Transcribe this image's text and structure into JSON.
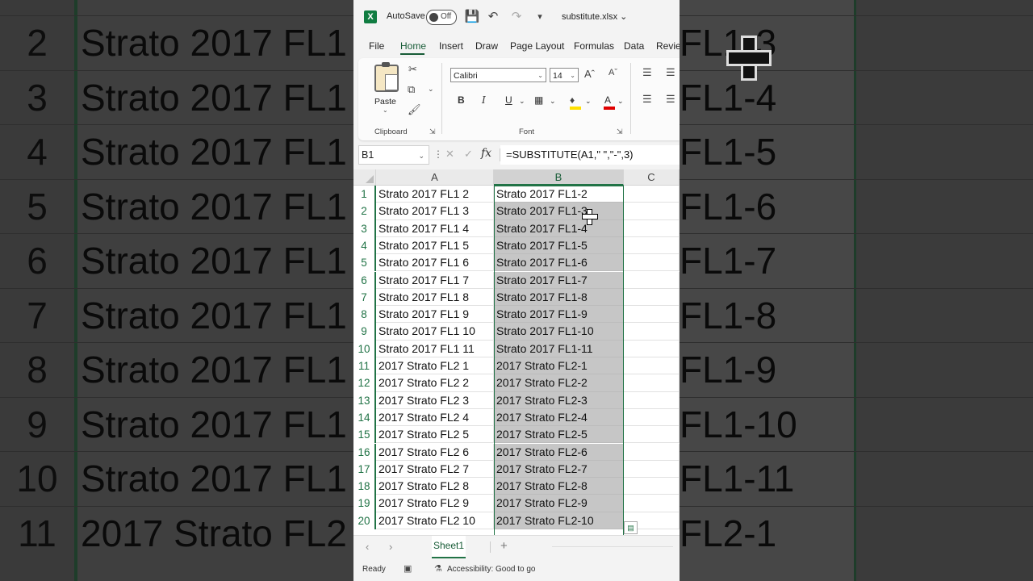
{
  "window": {
    "autosave_label": "AutoSave",
    "autosave_state": "Off",
    "filename": "substitute.xlsx",
    "accent": "#217346"
  },
  "menu": [
    "File",
    "Home",
    "Insert",
    "Draw",
    "Page Layout",
    "Formulas",
    "Data",
    "Revie"
  ],
  "ribbon": {
    "paste_label": "Paste",
    "clipboard_label": "Clipboard",
    "font_label": "Font",
    "font_name": "Calibri",
    "font_size": "14"
  },
  "formula_bar": {
    "name_box": "B1",
    "formula": "=SUBSTITUTE(A1,\" \",\"-\",3)"
  },
  "columns": [
    "A",
    "B",
    "C"
  ],
  "rows": [
    {
      "n": "1",
      "a": "Strato 2017 FL1 2",
      "b": "Strato 2017 FL1-2"
    },
    {
      "n": "2",
      "a": "Strato 2017 FL1 3",
      "b": "Strato 2017 FL1-3"
    },
    {
      "n": "3",
      "a": "Strato 2017 FL1 4",
      "b": "Strato 2017 FL1-4"
    },
    {
      "n": "4",
      "a": "Strato 2017 FL1 5",
      "b": "Strato 2017 FL1-5"
    },
    {
      "n": "5",
      "a": "Strato 2017 FL1 6",
      "b": "Strato 2017 FL1-6"
    },
    {
      "n": "6",
      "a": "Strato 2017 FL1 7",
      "b": "Strato 2017 FL1-7"
    },
    {
      "n": "7",
      "a": "Strato 2017 FL1 8",
      "b": "Strato 2017 FL1-8"
    },
    {
      "n": "8",
      "a": "Strato 2017 FL1 9",
      "b": "Strato 2017 FL1-9"
    },
    {
      "n": "9",
      "a": "Strato 2017 FL1 10",
      "b": "Strato 2017 FL1-10"
    },
    {
      "n": "10",
      "a": "Strato 2017 FL1 11",
      "b": "Strato 2017 FL1-11"
    },
    {
      "n": "11",
      "a": "2017 Strato FL2 1",
      "b": "2017 Strato FL2-1"
    },
    {
      "n": "12",
      "a": "2017 Strato FL2 2",
      "b": "2017 Strato FL2-2"
    },
    {
      "n": "13",
      "a": "2017 Strato FL2 3",
      "b": "2017 Strato FL2-3"
    },
    {
      "n": "14",
      "a": "2017 Strato FL2 4",
      "b": "2017 Strato FL2-4"
    },
    {
      "n": "15",
      "a": "2017 Strato FL2 5",
      "b": "2017 Strato FL2-5"
    },
    {
      "n": "16",
      "a": "2017 Strato FL2 6",
      "b": "2017 Strato FL2-6"
    },
    {
      "n": "17",
      "a": "2017 Strato FL2 7",
      "b": "2017 Strato FL2-7"
    },
    {
      "n": "18",
      "a": "2017 Strato FL2 8",
      "b": "2017 Strato FL2-8"
    },
    {
      "n": "19",
      "a": "2017 Strato FL2 9",
      "b": "2017 Strato FL2-9"
    },
    {
      "n": "20",
      "a": "2017 Strato FL2 10",
      "b": "2017 Strato FL2-10"
    }
  ],
  "sheet_tab": "Sheet1",
  "status": {
    "ready": "Ready",
    "accessibility": "Accessibility: Good to go"
  },
  "background_zoom": {
    "rows": [
      {
        "n": "2",
        "text": "Strato 2017 FL1",
        "right": "FL1-3"
      },
      {
        "n": "3",
        "text": "Strato 2017 FL1",
        "right": "FL1-4"
      },
      {
        "n": "4",
        "text": "Strato 2017 FL1",
        "right": "FL1-5"
      },
      {
        "n": "5",
        "text": "Strato 2017 FL1",
        "right": "FL1-6"
      },
      {
        "n": "6",
        "text": "Strato 2017 FL1",
        "right": "FL1-7"
      },
      {
        "n": "7",
        "text": "Strato 2017 FL1",
        "right": "FL1-8"
      },
      {
        "n": "8",
        "text": "Strato 2017 FL1",
        "right": "FL1-9"
      },
      {
        "n": "9",
        "text": "Strato 2017 FL1",
        "right": "FL1-10"
      },
      {
        "n": "10",
        "text": "Strato 2017 FL1",
        "right": "FL1-11"
      },
      {
        "n": "11",
        "text": "2017 Strato FL2",
        "right": "FL2-1"
      }
    ]
  }
}
